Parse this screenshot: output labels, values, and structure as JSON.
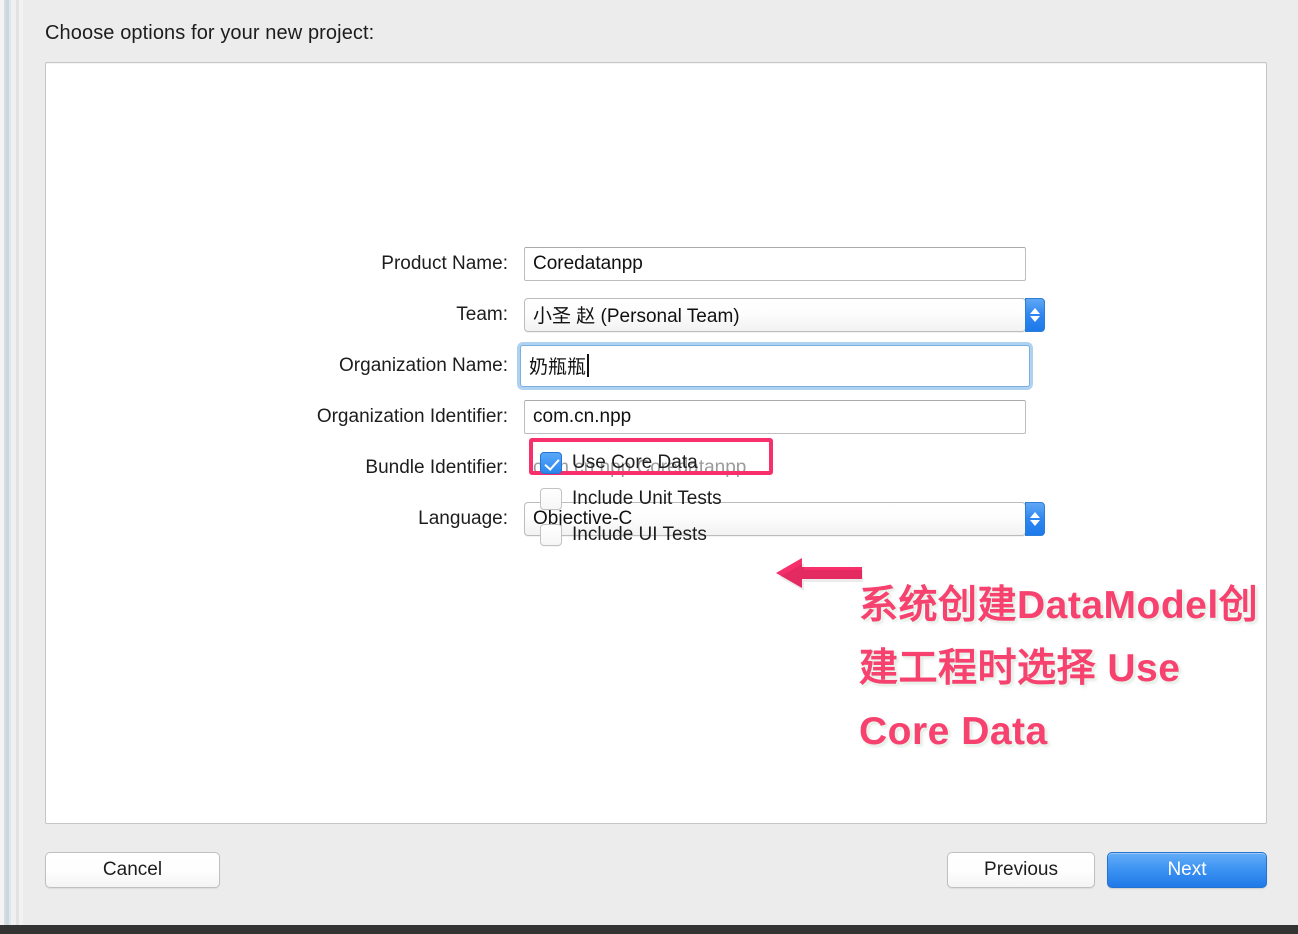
{
  "dialog": {
    "headline": "Choose options for your new project:"
  },
  "form": {
    "fields": [
      {
        "label": "Product Name:",
        "value": "Coredatanpp",
        "kind": "text"
      },
      {
        "label": "Team:",
        "value": "小圣 赵 (Personal Team)",
        "kind": "popup"
      },
      {
        "label": "Organization Name:",
        "value": "奶瓶瓶",
        "kind": "text-focused"
      },
      {
        "label": "Organization Identifier:",
        "value": "com.cn.npp",
        "kind": "text"
      },
      {
        "label": "Bundle Identifier:",
        "value": "com.cn.npp.Coredatanpp",
        "kind": "static"
      },
      {
        "label": "Language:",
        "value": "Objective-C",
        "kind": "popup"
      }
    ]
  },
  "checkboxes": [
    {
      "label": "Use Core Data",
      "checked": true,
      "highlighted": true
    },
    {
      "label": "Include Unit Tests",
      "checked": false,
      "highlighted": false
    },
    {
      "label": "Include UI Tests",
      "checked": false,
      "highlighted": false
    }
  ],
  "annotation": {
    "lines": [
      "系统创建DataModel创",
      "建工程时选择 Use",
      "Core Data"
    ],
    "color": "#f7416e"
  },
  "buttons": {
    "cancel": "Cancel",
    "previous": "Previous",
    "next": "Next"
  },
  "colors": {
    "accent_blue": "#2f86ef",
    "highlight_pink": "#f72f6b",
    "panel_background": "#ffffff",
    "dialog_background": "#ececec"
  }
}
